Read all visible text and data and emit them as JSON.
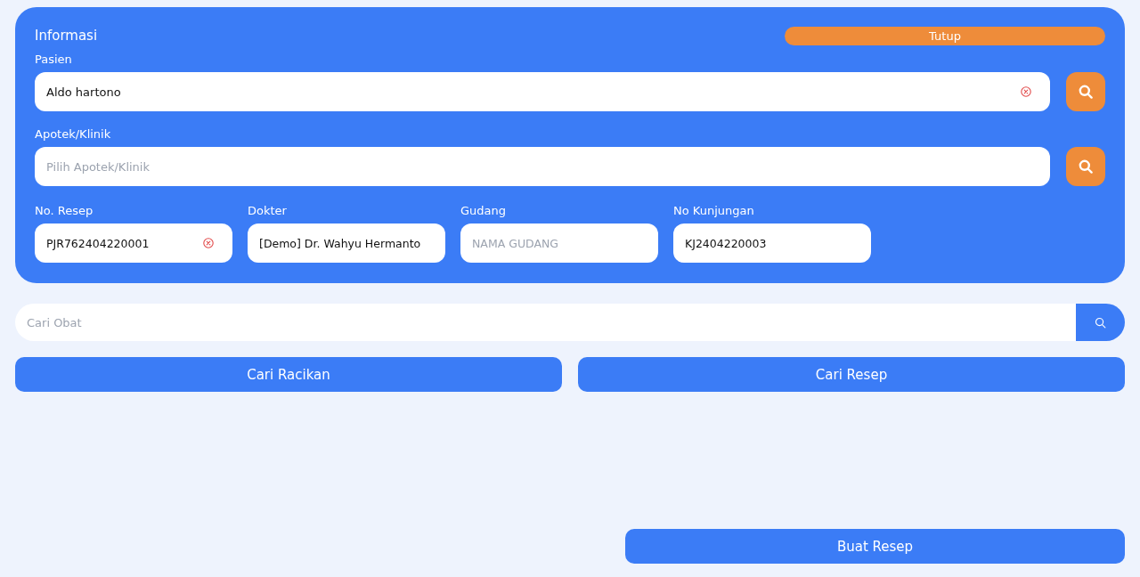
{
  "panel": {
    "title": "Informasi",
    "close_button": "Tutup",
    "lookup_fields": [
      {
        "label": "Pasien",
        "value": "Aldo hartono",
        "clearable": true
      },
      {
        "label": "Apotek/Klinik",
        "placeholder": "Pilih Apotek/Klinik",
        "clearable": false
      }
    ],
    "fields": [
      {
        "label": "No. Resep",
        "value": "PJR762404220001",
        "clearable": true
      },
      {
        "label": "Dokter",
        "value": "[Demo] Dr. Wahyu Hermanto",
        "clearable": false
      },
      {
        "label": "Gudang",
        "placeholder": "NAMA GUDANG",
        "clearable": false
      },
      {
        "label": "No Kunjungan",
        "value": "KJ2404220003",
        "clearable": false
      }
    ]
  },
  "medicine_search": {
    "placeholder": "Cari Obat"
  },
  "actions": [
    "Cari Racikan",
    "Cari Resep"
  ],
  "submit_button": "Buat Resep"
}
